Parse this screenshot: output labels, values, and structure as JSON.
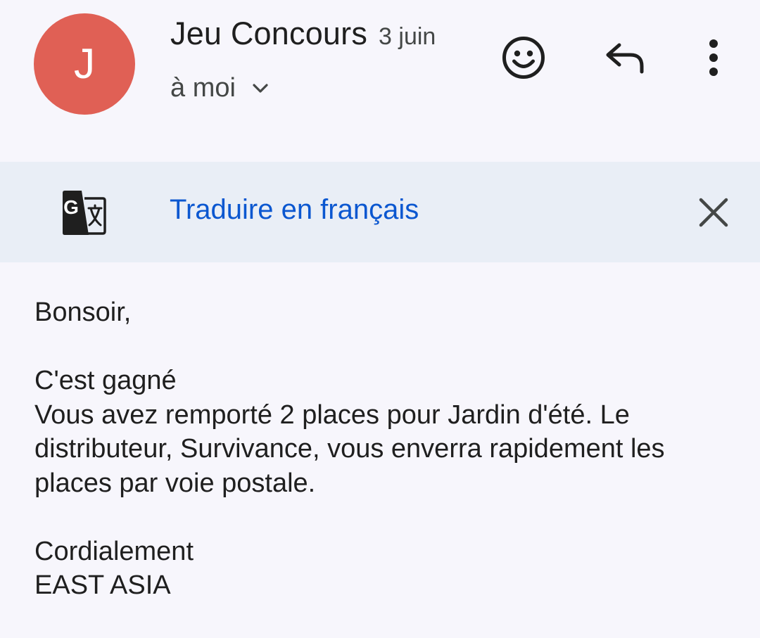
{
  "header": {
    "avatar_letter": "J",
    "sender_name": "Jeu Concours",
    "date": "3 juin",
    "recipient": "à moi",
    "avatar_color": "#e06055"
  },
  "actions": {
    "emoji_icon": "smiley-icon",
    "reply_icon": "reply-icon",
    "more_icon": "more-vertical-icon"
  },
  "translate_bar": {
    "icon": "google-translate-icon",
    "link_label": "Traduire en français",
    "close_icon": "close-icon",
    "link_color": "#0b57d0",
    "background": "#e9eef6"
  },
  "message": {
    "greeting": "Bonsoir,",
    "line1": "C'est gagné",
    "line2": "Vous avez remporté 2 places pour Jardin d'été. Le distributeur, Survivance, vous enverra rapidement les places par voie postale.",
    "closing": "Cordialement",
    "signature": "EAST ASIA"
  }
}
